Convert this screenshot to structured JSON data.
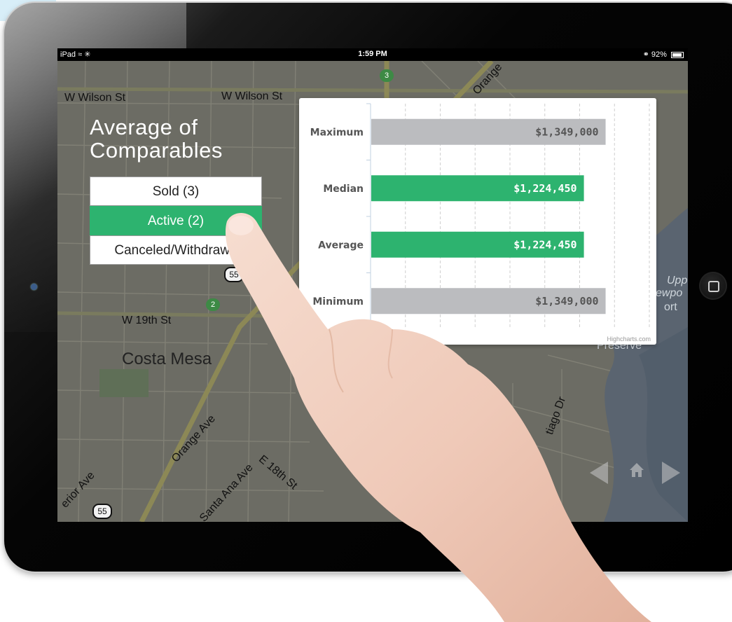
{
  "status_bar": {
    "device": "iPad",
    "time": "1:59 PM",
    "battery": "92%"
  },
  "map": {
    "streets": [
      "W Wilson St",
      "W Wilson St",
      "W 19th St",
      "Costa Mesa",
      "Orange Ave",
      "E 18th St",
      "Santa Ana Ave",
      "Orange",
      "erior Ave",
      "Upp",
      "ewpo",
      "ort",
      "Preserve",
      "tiago Dr"
    ],
    "shields": [
      "55",
      "55"
    ],
    "routes": [
      "3",
      "2"
    ]
  },
  "panel": {
    "title_line1": "Average of",
    "title_line2": "Comparables",
    "filters": [
      {
        "label": "Sold (3)",
        "active": false
      },
      {
        "label": "Active (2)",
        "active": true
      },
      {
        "label": "Canceled/Withdrawn",
        "active": false
      }
    ]
  },
  "chart_data": {
    "type": "bar",
    "orientation": "horizontal",
    "categories": [
      "Maximum",
      "Median",
      "Average",
      "Minimum"
    ],
    "values": [
      1349000,
      1224450,
      1224450,
      1349000
    ],
    "value_labels": [
      "$1,349,000",
      "$1,224,450",
      "$1,224,450",
      "$1,349,000"
    ],
    "colors": [
      "#bbbcbf",
      "#2db36f",
      "#2db36f",
      "#bbbcbf"
    ],
    "xlim": [
      0,
      1600000
    ],
    "grid": true,
    "credit": "Highcharts.com"
  },
  "colors": {
    "accent": "#2db36f",
    "gray_bar": "#bbbcbf"
  }
}
